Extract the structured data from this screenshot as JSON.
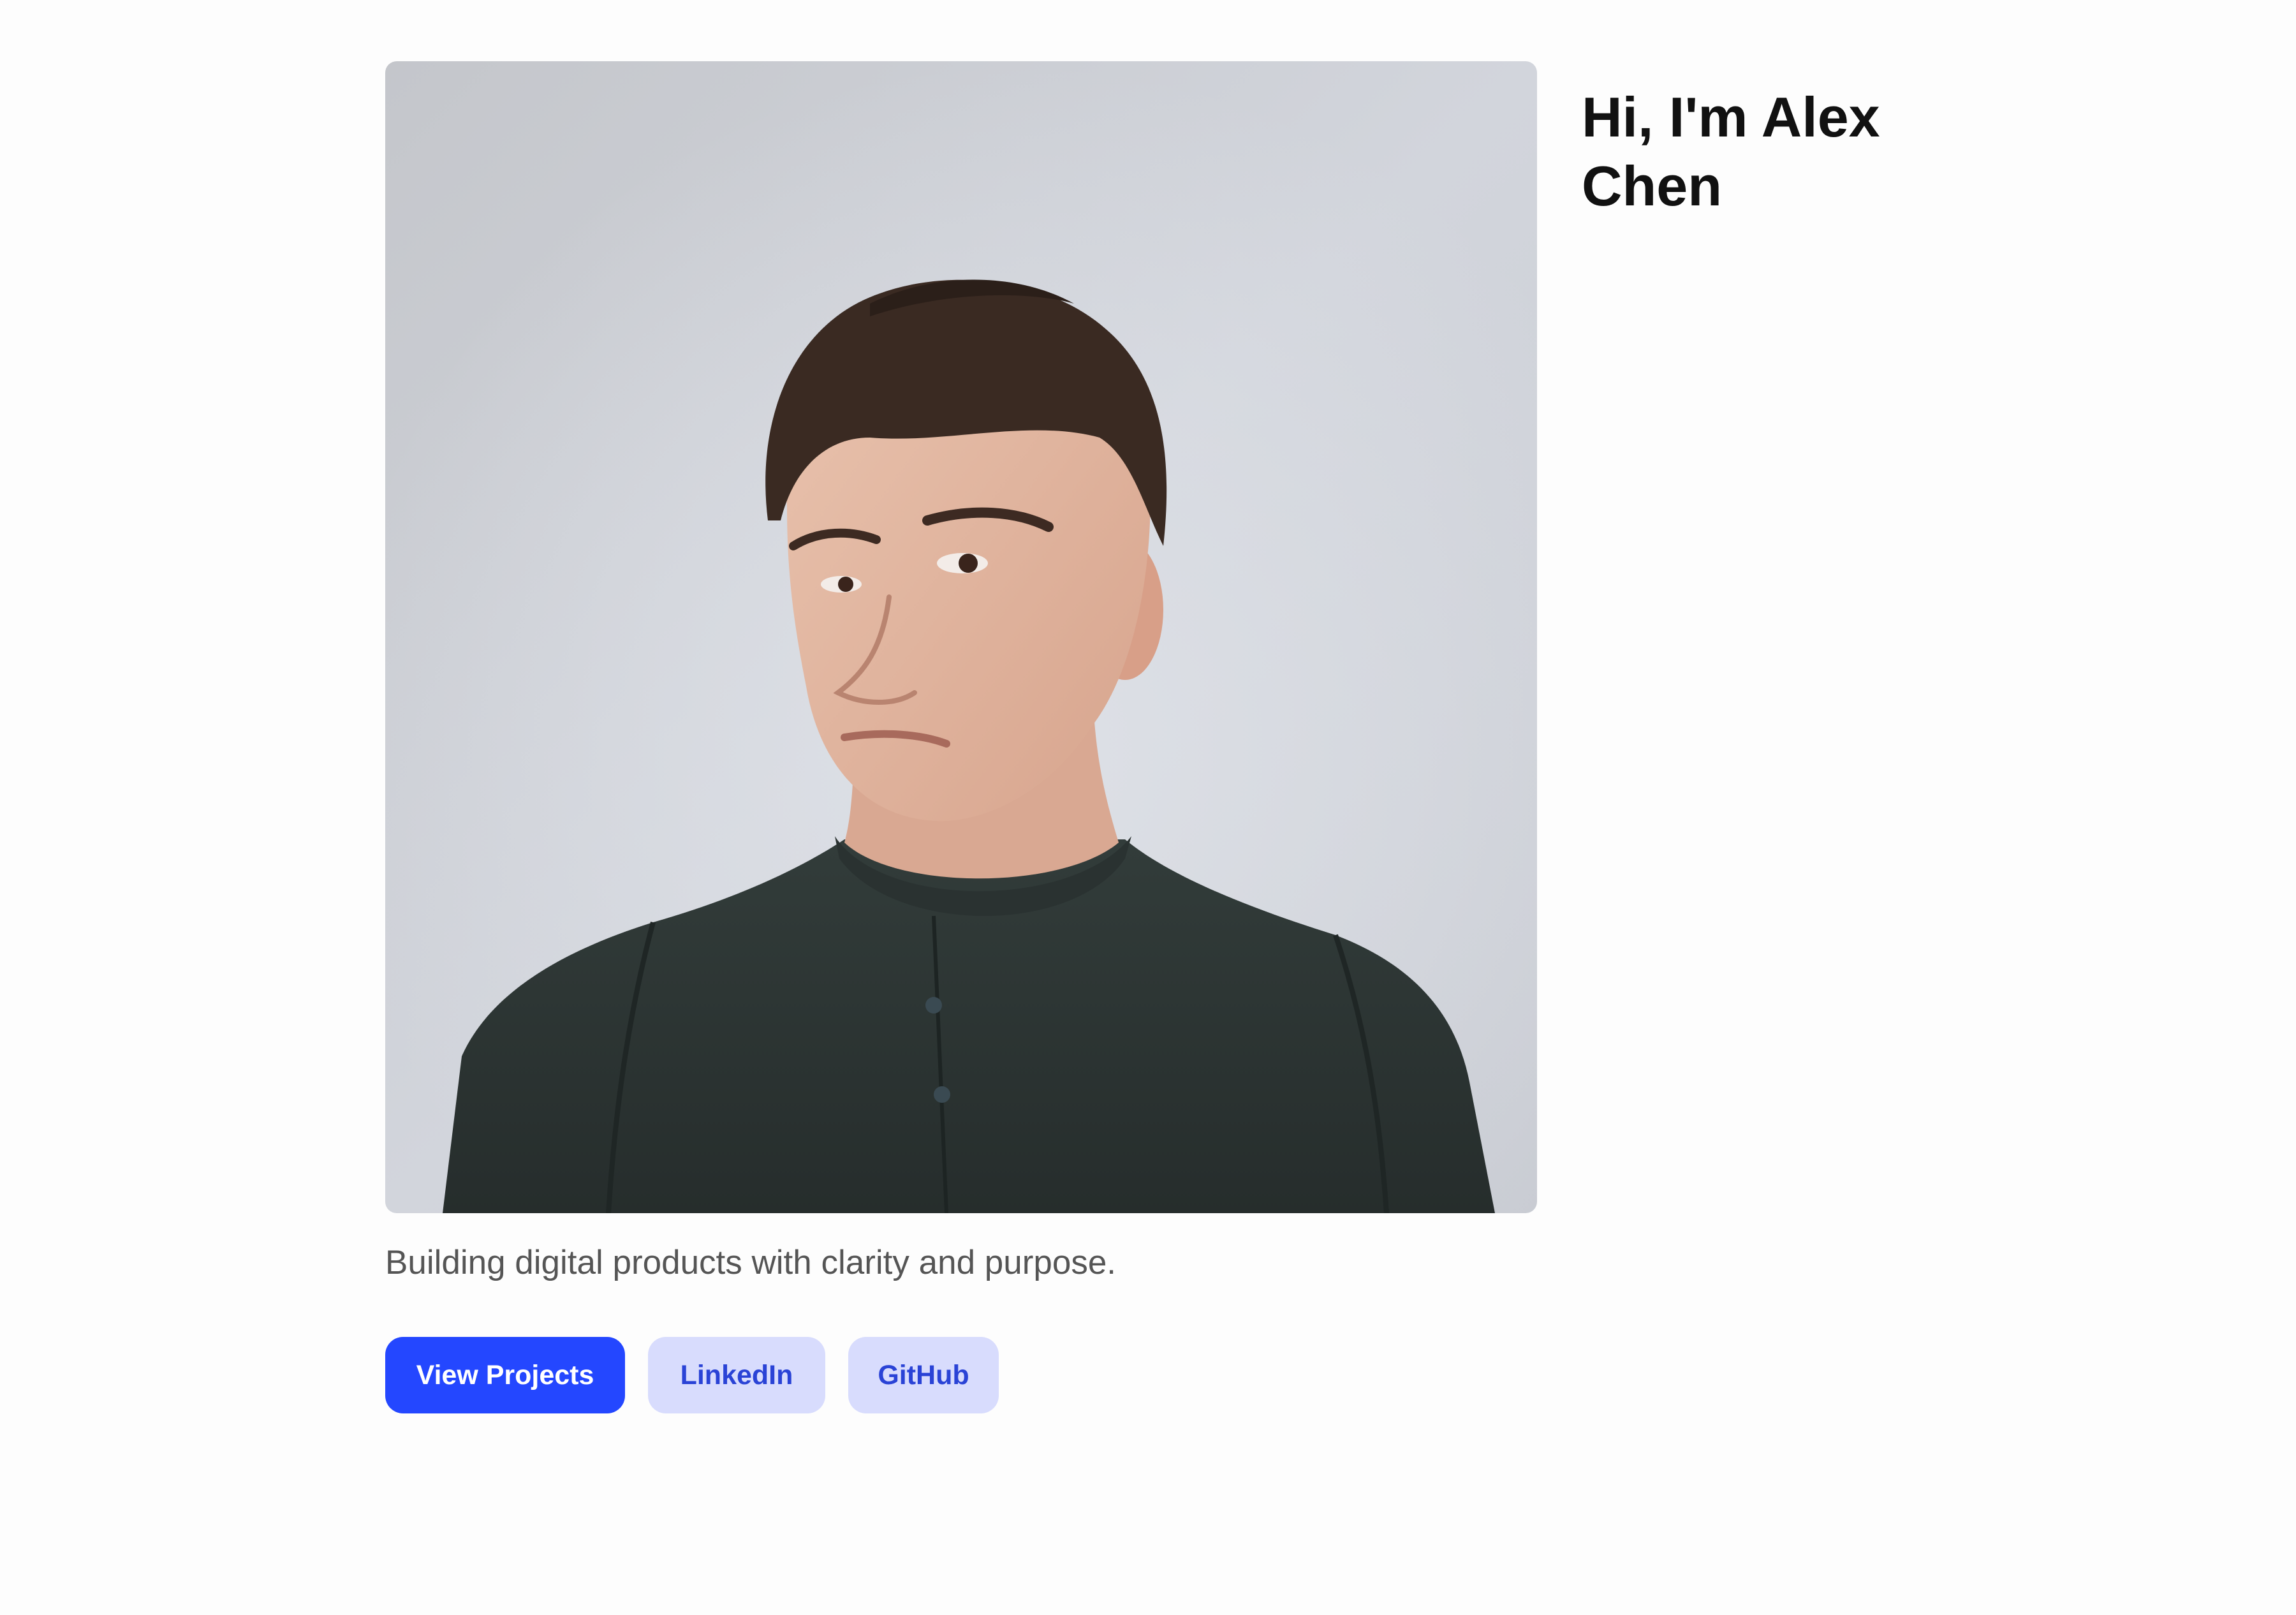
{
  "hero": {
    "heading": "Hi, I'm Alex Chen",
    "tagline": "Building digital products with clarity and purpose.",
    "photo_subject": "portrait of a young man in a dark green band-collar shirt against a light grey backdrop"
  },
  "actions": {
    "primary_label": "View Projects",
    "linkedin_label": "LinkedIn",
    "github_label": "GitHub"
  },
  "colors": {
    "accent": "#2447ff",
    "secondary_button_bg": "#d8dcfd",
    "secondary_button_text": "#2a43d6",
    "heading_text": "#111111",
    "body_text": "#555555",
    "background": "#fdfdfd"
  }
}
